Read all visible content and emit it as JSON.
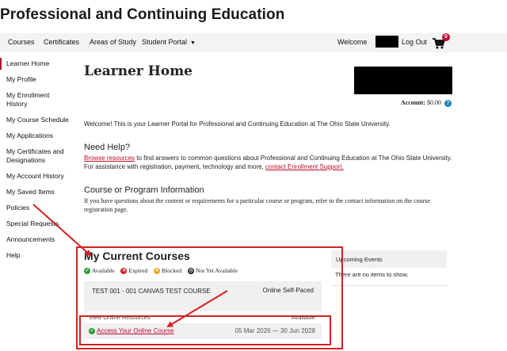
{
  "site": {
    "title": "Professional and Continuing Education"
  },
  "nav": {
    "items": [
      "Courses",
      "Certificates",
      "Areas of Study",
      "Student Portal"
    ],
    "welcome": "Welcome",
    "logout": "Log Out",
    "cart_count": "0"
  },
  "sidebar": {
    "items": [
      "Learner Home",
      "My Profile",
      "My Enrollment History",
      "My Course Schedule",
      "My Applications",
      "My Certificates and Designations",
      "My Account History",
      "My Saved Items",
      "Policies",
      "Special Requests",
      "Announcements",
      "Help"
    ]
  },
  "main": {
    "title": "Learner Home",
    "account_label": "Account:",
    "account_value": "$0.00",
    "welcome": "Welcome! This is your Learner Portal for Professional and Continuing Education at The Ohio State University.",
    "help": {
      "heading": "Need Help?",
      "link1": "Browse resources",
      "text": " to find answers to common questions about Professional and Continuing Education at The Ohio State University. For assistance with registration, payment, technology and more, ",
      "link2": "contact Enrollment Support."
    },
    "info": {
      "heading": "Course or Program Information",
      "text": "If you have questions about the content or requirements for a particular course or program, refer to the contact information on the course registration page."
    }
  },
  "courses": {
    "title": "My Current Courses",
    "legend": [
      "Available",
      "Expired",
      "Blocked",
      "Not Yet Available"
    ],
    "course_name": "TEST 001 - 001 CANVAS TEST COURSE",
    "course_type": "Online Self-Paced",
    "resources_label": "View Online Resources",
    "resources_status": "Available",
    "access_link": "Access Your Online Course",
    "access_dates": "05 Mar 2026 — 30 Jun 2028"
  },
  "upcoming": {
    "title": "Upcoming Events",
    "empty": "There are no items to show."
  },
  "colors": {
    "brand_red": "#ba0c2f",
    "available": "#2e9e3b",
    "expired": "#d42020",
    "blocked": "#e8a317",
    "annotation": "#d42020"
  }
}
